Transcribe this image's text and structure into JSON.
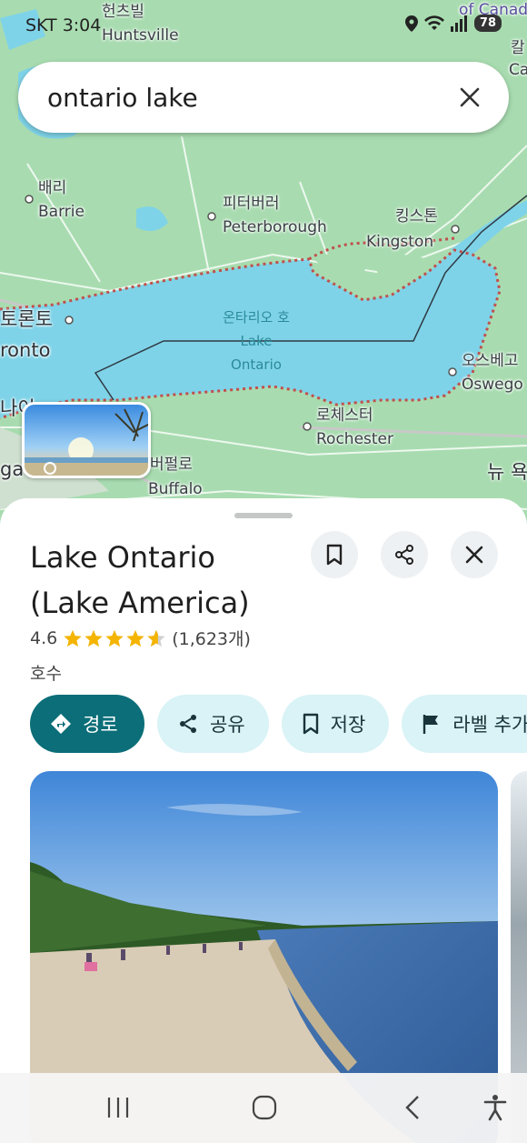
{
  "status": {
    "time": "SKT 3:04",
    "battery": "78",
    "icons": [
      "location-pin-icon",
      "wifi-icon",
      "signal-icon"
    ]
  },
  "search": {
    "query": "ontario lake",
    "clear_icon": "close-icon"
  },
  "map": {
    "labels": {
      "huntsville_ko": "헌츠빌",
      "huntsville_en": "Huntsville",
      "canada_partial": "of Canad",
      "barrie_ko": "배리",
      "barrie_en": "Barrie",
      "peterborough_ko": "피터버러",
      "peterborough_en": "Peterborough",
      "kingston_ko": "킹스톤",
      "kingston_en": "Kingston",
      "toronto_ko": "토론토",
      "toronto_en": "ronto",
      "lake_ko": "온타리오 호",
      "lake_en_1": "Lake",
      "lake_en_2": "Ontario",
      "oswego_ko": "오스베고",
      "oswego_en": "Oswego",
      "niagara_ko": "나이",
      "niagara_en": "ga",
      "rochester_ko": "로체스터",
      "rochester_en": "Rochester",
      "buffalo_ko": "버펄로",
      "buffalo_en": "Buffalo",
      "newyork_ko": "뉴 욕",
      "edge_ko_1": "칼",
      "edge_ko_2": "Ca"
    },
    "colors": {
      "land": "#a8dcb0",
      "water": "#7fd3e8",
      "boundary": "#c0504d"
    }
  },
  "place": {
    "title_line1": "Lake Ontario",
    "title_line2": "(Lake America)",
    "rating": "4.6",
    "stars_filled": 4.6,
    "reviews": "(1,623개)",
    "type": "호수",
    "header_buttons": {
      "save_icon": "bookmark-icon",
      "share_icon": "share-icon",
      "close_icon": "close-icon"
    }
  },
  "actions": [
    {
      "label": "경로",
      "icon": "directions-icon",
      "style": "primary"
    },
    {
      "label": "공유",
      "icon": "share-icon",
      "style": "secondary"
    },
    {
      "label": "저장",
      "icon": "bookmark-icon",
      "style": "secondary"
    },
    {
      "label": "라벨 추가",
      "icon": "flag-icon",
      "style": "secondary"
    }
  ],
  "navbar": {
    "recents_icon": "recent-apps-icon",
    "home_icon": "home-icon",
    "back_icon": "back-icon",
    "accessibility_icon": "accessibility-icon"
  },
  "theme": {
    "accent": "#0b6e78",
    "chip_bg": "#d9f3f6",
    "star": "#f4b400"
  }
}
